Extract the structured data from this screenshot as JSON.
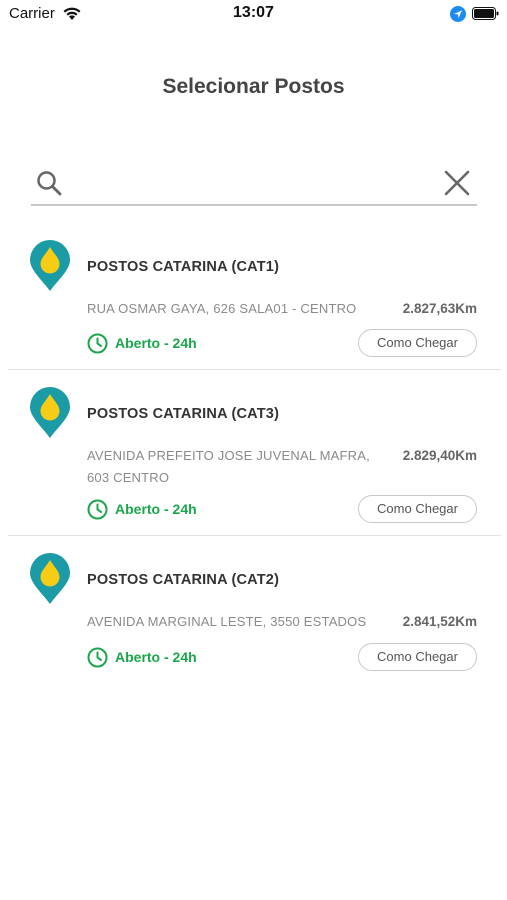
{
  "status_bar": {
    "carrier": "Carrier",
    "time": "13:07"
  },
  "header": {
    "title": "Selecionar Postos"
  },
  "search": {
    "value": "",
    "placeholder": ""
  },
  "colors": {
    "pin_teal": "#1a9ba5",
    "pin_yellow": "#f7cc14",
    "open_green": "#1aa64b",
    "location_blue": "#1e8bf3"
  },
  "icons": {
    "search": "search-icon",
    "clear": "close-icon",
    "pin": "map-pin-icon",
    "clock": "clock-icon"
  },
  "stations": [
    {
      "name": "POSTOS CATARINA (CAT1)",
      "address": "RUA OSMAR GAYA, 626 SALA01 - CENTRO",
      "distance": "2.827,63Km",
      "status": "Aberto - 24h",
      "route_label": "Como Chegar"
    },
    {
      "name": "POSTOS CATARINA (CAT3)",
      "address": "AVENIDA PREFEITO JOSE JUVENAL MAFRA, 603 CENTRO",
      "distance": "2.829,40Km",
      "status": "Aberto - 24h",
      "route_label": "Como Chegar"
    },
    {
      "name": "POSTOS CATARINA (CAT2)",
      "address": "AVENIDA MARGINAL LESTE, 3550 ESTADOS",
      "distance": "2.841,52Km",
      "status": "Aberto - 24h",
      "route_label": "Como Chegar"
    }
  ]
}
